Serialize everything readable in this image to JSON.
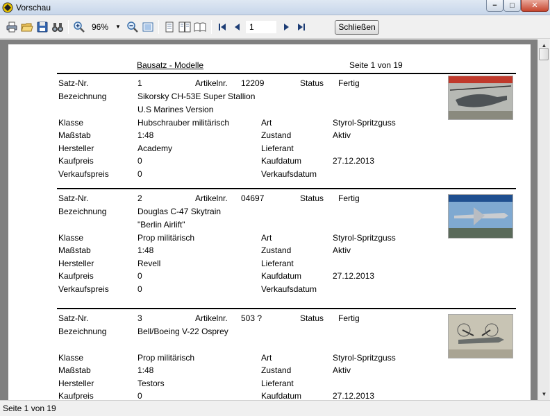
{
  "window": {
    "title": "Vorschau",
    "minimize_label": "−",
    "maximize_label": "□",
    "close_label": "✕"
  },
  "toolbar": {
    "zoom_value": "96%",
    "page_value": "1",
    "close_button_label": "Schließen",
    "icons": [
      "printer-icon",
      "open-folder-icon",
      "save-disk-icon",
      "binoculars-icon",
      "zoom-in-icon",
      "zoom-out-icon",
      "fit-page-icon",
      "single-page-icon",
      "two-page-icon",
      "book-view-icon",
      "first-page-icon",
      "prev-page-icon",
      "next-page-icon",
      "last-page-icon"
    ]
  },
  "report": {
    "title": "Bausatz - Modelle",
    "page_info": "Seite 1 von 19",
    "labels": {
      "satz_nr": "Satz-Nr.",
      "bezeichnung": "Bezeichnung",
      "artikelnr": "Artikelnr.",
      "status": "Status",
      "klasse": "Klasse",
      "art": "Art",
      "massstab": "Maßstab",
      "zustand": "Zustand",
      "hersteller": "Hersteller",
      "lieferant": "Lieferant",
      "kaufpreis": "Kaufpreis",
      "kaufdatum": "Kaufdatum",
      "verkaufspreis": "Verkaufspreis",
      "verkaufsdatum": "Verkaufsdatum"
    },
    "records": [
      {
        "satz_nr": "1",
        "artikelnr": "12209",
        "status": "Fertig",
        "bezeichnung": "Sikorsky CH-53E Super Stallion",
        "bezeichnung2": "U.S Marines Version",
        "klasse": "Hubschrauber militärisch",
        "art": "Styrol-Spritzguss",
        "massstab": "1:48",
        "zustand": "Aktiv",
        "hersteller": "Academy",
        "lieferant": "",
        "kaufpreis": "0",
        "kaufdatum": "27.12.2013",
        "verkaufspreis": "0",
        "verkaufsdatum": ""
      },
      {
        "satz_nr": "2",
        "artikelnr": "04697",
        "status": "Fertig",
        "bezeichnung": "Douglas C-47 Skytrain",
        "bezeichnung2": "\"Berlin Airlift\"",
        "klasse": "Prop militärisch",
        "art": "Styrol-Spritzguss",
        "massstab": "1:48",
        "zustand": "Aktiv",
        "hersteller": "Revell",
        "lieferant": "",
        "kaufpreis": "0",
        "kaufdatum": "27.12.2013",
        "verkaufspreis": "0",
        "verkaufsdatum": ""
      },
      {
        "satz_nr": "3",
        "artikelnr": "503 ?",
        "status": "Fertig",
        "bezeichnung": "Bell/Boeing V-22 Osprey",
        "bezeichnung2": "",
        "klasse": "Prop militärisch",
        "art": "Styrol-Spritzguss",
        "massstab": "1:48",
        "zustand": "Aktiv",
        "hersteller": "Testors",
        "lieferant": "",
        "kaufpreis": "0",
        "kaufdatum": "27.12.2013"
      }
    ]
  },
  "statusbar": {
    "text": "Seite 1 von 19"
  }
}
